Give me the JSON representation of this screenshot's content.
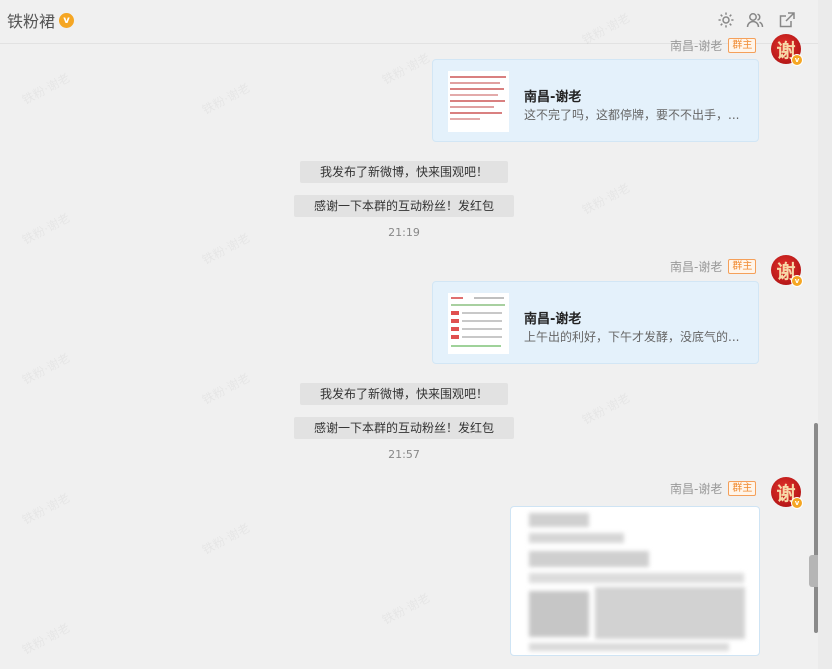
{
  "header": {
    "title": "铁粉裙",
    "verify_badge": "v",
    "icons": [
      "gear-icon",
      "members-icon",
      "open-external-icon"
    ]
  },
  "watermark": "铁粉·谢老",
  "messages": [
    {
      "sender": "南昌-谢老",
      "role": "群主",
      "avatar_char": "谢",
      "card_title": "南昌-谢老",
      "card_desc": "这不完了吗，这都停牌，要不不出手，..."
    },
    {
      "sys_1": "我发布了新微博，快来围观吧！",
      "sys_2": "感谢一下本群的互动粉丝！发红包",
      "time": "21:19"
    },
    {
      "sender": "南昌-谢老",
      "role": "群主",
      "avatar_char": "谢",
      "card_title": "南昌-谢老",
      "card_desc": "上午出的利好，下午才发酵，没底气的..."
    },
    {
      "sys_1": "我发布了新微博，快来围观吧！",
      "sys_2": "感谢一下本群的互动粉丝！发红包",
      "time": "21:57"
    },
    {
      "sender": "南昌-谢老",
      "role": "群主",
      "avatar_char": "谢"
    }
  ],
  "colors": {
    "card_bg": "#e4f1fb",
    "role_badge": "#f08a30",
    "avatar_red": "#c41e1e"
  }
}
